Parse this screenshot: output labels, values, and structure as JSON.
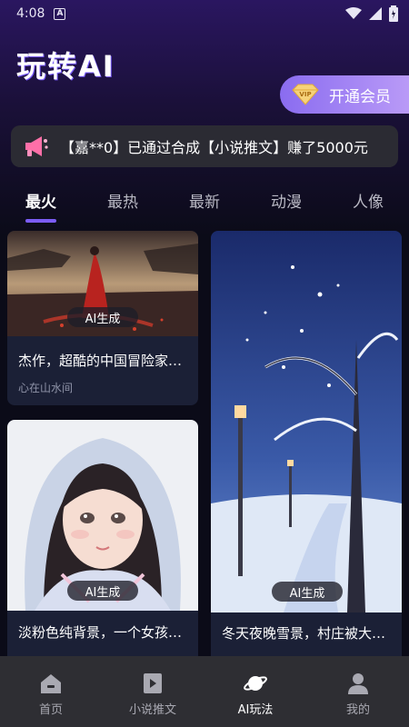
{
  "status_bar": {
    "time": "4:08",
    "notification_badge": "A"
  },
  "header": {
    "title": "玩转AI",
    "vip_button_label": "开通会员",
    "vip_icon_text": "VIP"
  },
  "notice": {
    "text": "【嘉**0】已通过合成【小说推文】赚了5000元"
  },
  "tabs": [
    {
      "label": "最火",
      "active": true
    },
    {
      "label": "最热",
      "active": false
    },
    {
      "label": "最新",
      "active": false
    },
    {
      "label": "动漫",
      "active": false
    },
    {
      "label": "人像",
      "active": false
    }
  ],
  "cards": [
    {
      "title": "杰作，超酷的中国冒险家…",
      "author": "心在山水间",
      "badge": "AI生成"
    },
    {
      "title": "淡粉色纯背景，一个女孩…",
      "author": "",
      "badge": "AI生成"
    },
    {
      "title": "冬天夜晚雪景，村庄被大…",
      "author": "",
      "badge": "AI生成"
    }
  ],
  "bottom_nav": [
    {
      "label": "首页",
      "icon": "home-icon",
      "active": false
    },
    {
      "label": "小说推文",
      "icon": "video-icon",
      "active": false
    },
    {
      "label": "AI玩法",
      "icon": "planet-icon",
      "active": true
    },
    {
      "label": "我的",
      "icon": "profile-icon",
      "active": false
    }
  ],
  "colors": {
    "accent": "#7b5cf5",
    "vip_gradient_start": "#8a6cf0",
    "vip_gradient_end": "#b99af7",
    "card_bg": "#1b2036",
    "nav_bg": "#2e2e33"
  }
}
